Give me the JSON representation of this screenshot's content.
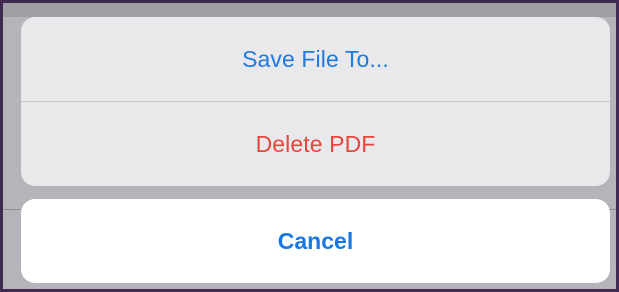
{
  "action_sheet": {
    "actions": [
      {
        "label": "Save File To...",
        "style": "default",
        "color": "#1e7ae0"
      },
      {
        "label": "Delete PDF",
        "style": "destructive",
        "color": "#e8453c"
      }
    ],
    "cancel": {
      "label": "Cancel",
      "color": "#1a76e0"
    }
  },
  "colors": {
    "backdrop": "#b4b4ba",
    "sheet_background": "#e9e9eb",
    "cancel_background": "#ffffff",
    "divider": "#c7c7cc",
    "frame": "#3e2a52"
  }
}
